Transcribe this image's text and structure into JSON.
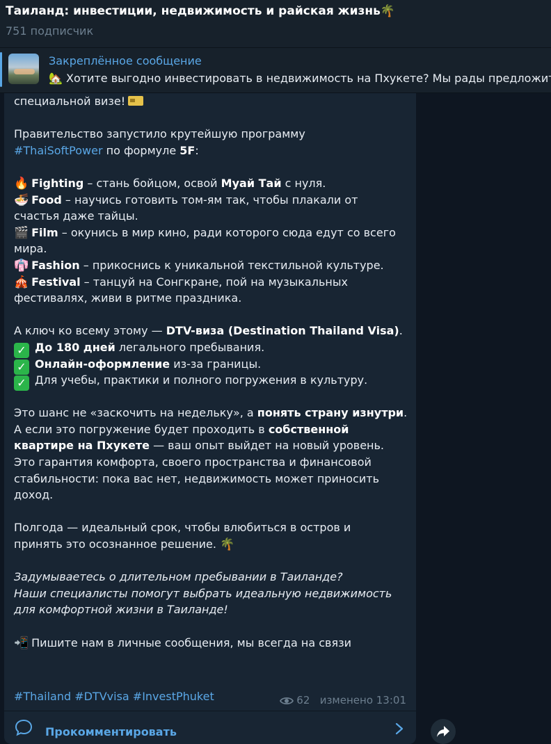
{
  "channel": {
    "title": "Таиланд: инвестиции, недвижимость и райская жизнь",
    "title_emoji": "🌴",
    "subscribers": "751 подписчик"
  },
  "pinned": {
    "label": "Закреплённое сообщение",
    "emoji": "🏡",
    "text": "Хотите выгодно инвестировать в недвижимость на Пхукете?   Мы рады предложить"
  },
  "post": {
    "l01": "специальной визе!",
    "l02": "Правительство запустило крутейшую программу",
    "l03_tag": "#ThaiSoftPower",
    "l03_text": " по формуле ",
    "l03_bold": "5F",
    "l03_end": ":",
    "fighting": {
      "emoji": "🔥",
      "bold": "Fighting",
      "text": " – стань бойцом, освой ",
      "bold2": "Муай Тай",
      "end": " с нуля."
    },
    "food": {
      "emoji": "🍜",
      "bold": "Food",
      "text": " – научись готовить том-ям так, чтобы плакали от",
      "cont": "счастья даже тайцы."
    },
    "film": {
      "emoji": "🎬",
      "bold": "Film",
      "text": " – окунись в мир кино, ради которого сюда едут со всего",
      "cont": "мира."
    },
    "fashion": {
      "emoji": "👘",
      "bold": "Fashion",
      "text": " – прикоснись к уникальной текстильной культуре."
    },
    "festival": {
      "emoji": "🎪",
      "bold": "Festival",
      "text": " – танцуй на Сонгкране, пой на музыкальных",
      "cont": "фестивалях, живи в ритме праздника."
    },
    "key_text": "А ключ ко всему этому — ",
    "key_bold": "DTV-виза (Destination Thailand Visa)",
    "key_end": ".",
    "check1_bold": "До 180 дней",
    "check1_text": " легального пребывания.",
    "check2_bold": "Онлайн-оформление",
    "check2_text": " из-за границы.",
    "check3_text": "Для учебы, практики и полного погружения в культуру.",
    "p1_a": "Это шанс не «заскочить на недельку», а ",
    "p1_bold": "понять страну изнутри",
    "p1_end": ".",
    "p2_a": "А если это погружение будет проходить в ",
    "p2_bold": "собственной",
    "p3_bold": "квартире на Пхукете",
    "p3_text": " — ваш опыт выйдет на новый уровень.",
    "p4": "Это гарантия комфорта, своего пространства и финансовой",
    "p5": "стабильности: пока вас нет, недвижимость может приносить",
    "p6": "доход.",
    "half1": "Полгода — идеальный срок, чтобы влюбиться в остров и",
    "half2": "принять это осознанное решение.",
    "half_emoji": "🌴",
    "it1": "Задумываетесь о длительном пребывании в Таиланде?",
    "it2": "Наши специалисты помогут выбрать идеальную недвижимость",
    "it3": "для комфортной жизни в Таиланде!",
    "cta_emoji": "📲",
    "cta": "Пишите нам в личные сообщения, мы всегда на связи",
    "hashtags": "#Thailand #DTVvisa #InvestPhuket",
    "views": "62",
    "edited": "изменено 13:01"
  },
  "comments": {
    "label": "Прокомментировать"
  },
  "colors": {
    "background": "#0e1621",
    "bubble": "#182533",
    "accent": "#5aa7e6",
    "muted": "#6d7f8f"
  }
}
